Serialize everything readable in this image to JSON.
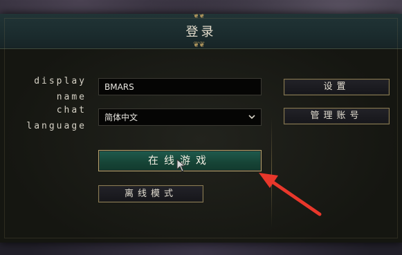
{
  "dialog": {
    "title": "登录",
    "display_name_label": "display name",
    "display_name_value": "BMARS",
    "chat_language_label": "chat language",
    "chat_language_value": "简体中文"
  },
  "buttons": {
    "settings": "设置",
    "manage_accounts": "管理账号",
    "play_online": "在线游戏",
    "offline_mode": "离线模式"
  },
  "icons": {
    "dropdown": "chevron-down-icon",
    "annotation": "red-arrow-icon",
    "pointer": "mouse-cursor-icon"
  },
  "colors": {
    "primary_button": "#1f5b4e",
    "button_border": "#8a7a54",
    "annotation_arrow": "#e8372b"
  }
}
